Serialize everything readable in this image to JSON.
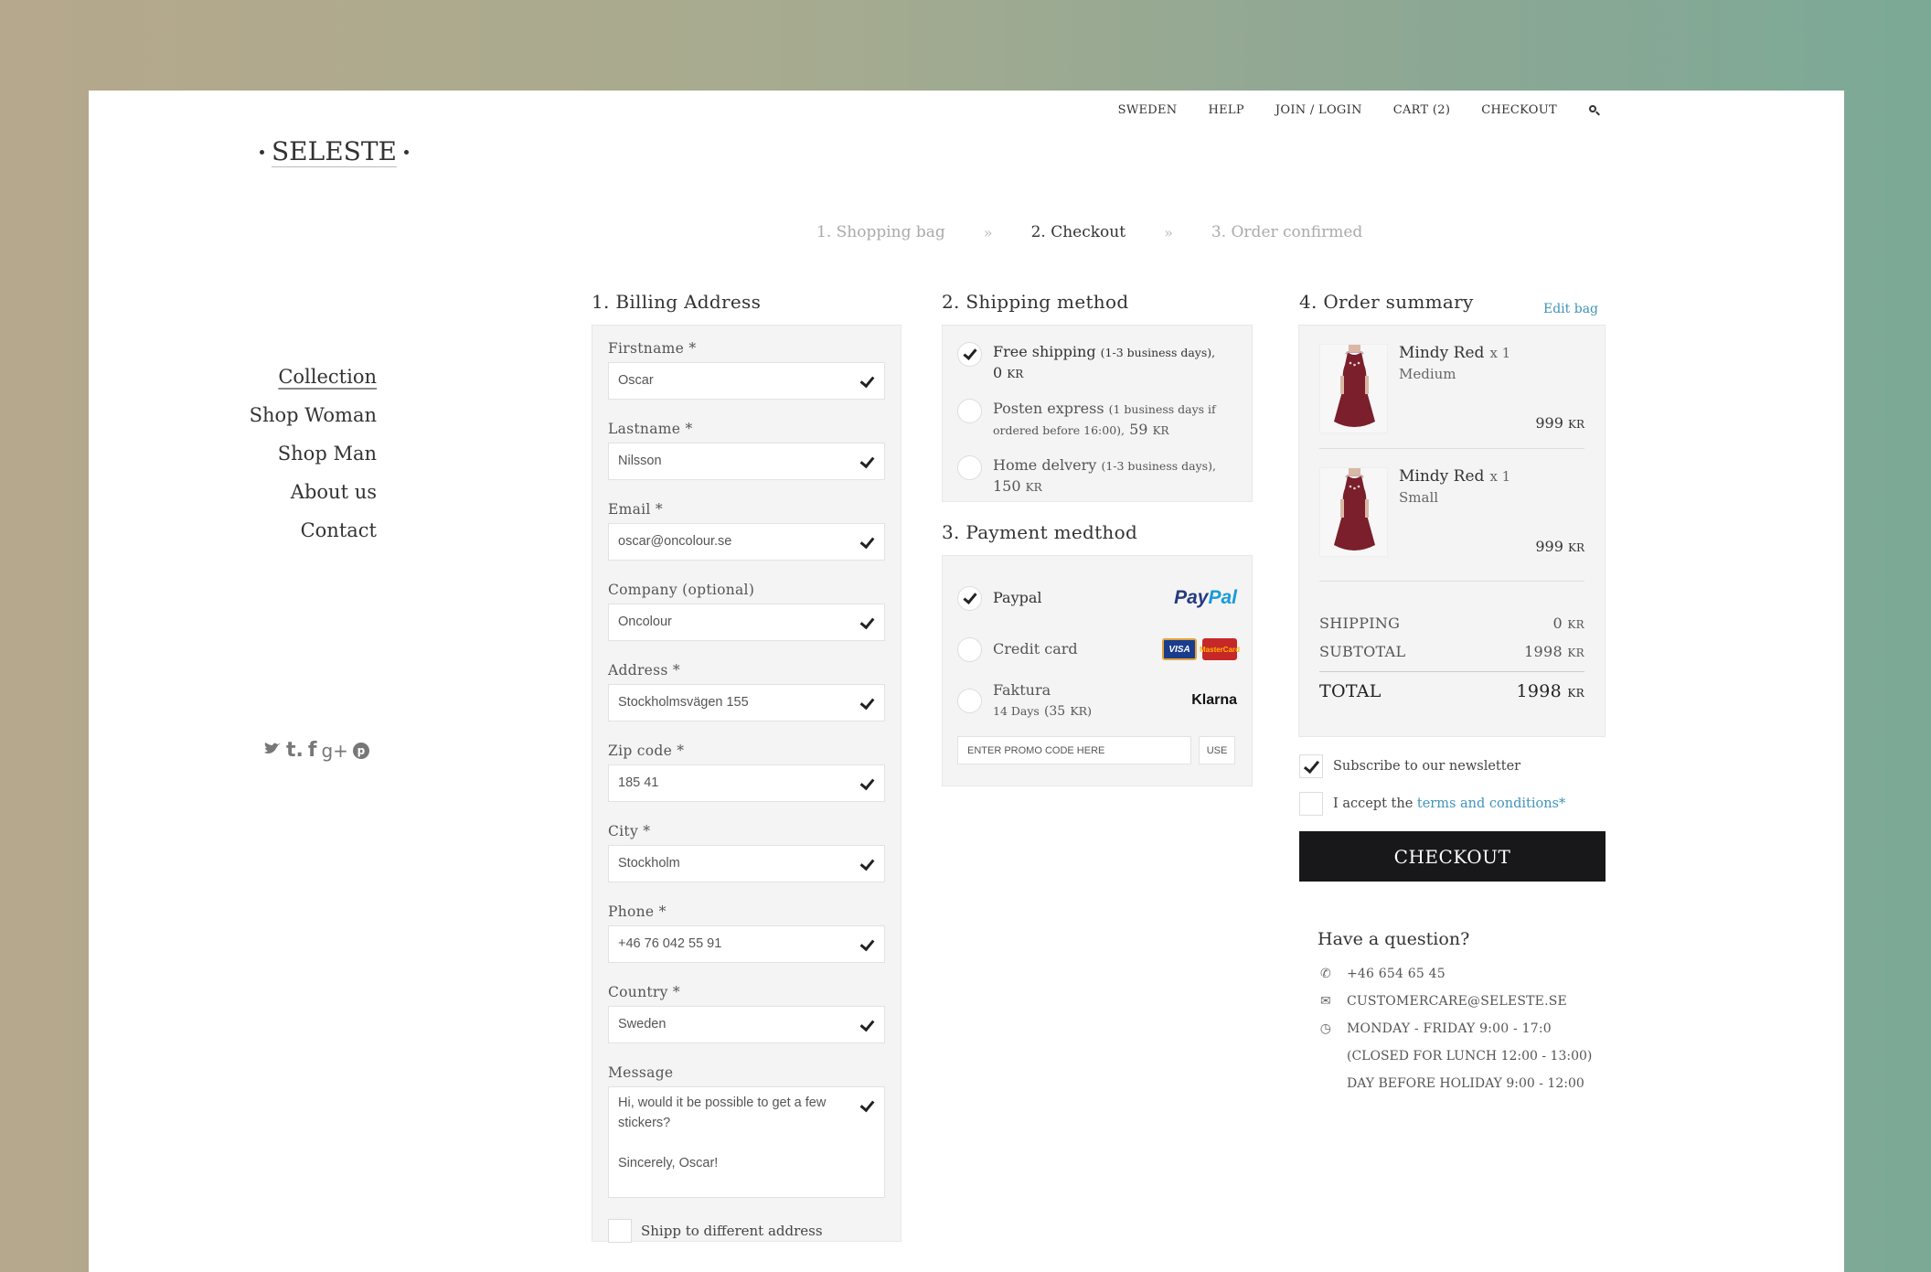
{
  "topnav": {
    "items": [
      "SWEDEN",
      "HELP",
      "JOIN / LOGIN",
      "CART (2)",
      "CHECKOUT"
    ],
    "search_icon": "search-icon"
  },
  "logo": {
    "text": "SELESTE"
  },
  "steps": [
    {
      "label": "1. Shopping bag",
      "active": false
    },
    {
      "label": "2. Checkout",
      "active": true
    },
    {
      "label": "3. Order confirmed",
      "active": false
    }
  ],
  "step_separator": "»",
  "sidenav": {
    "items": [
      "Collection",
      "Shop Woman",
      "Shop Man",
      "About us",
      "Contact"
    ]
  },
  "social": {
    "twitter": "twitter-icon",
    "tumblr": "t.",
    "facebook": "f",
    "googleplus": "g+",
    "pinterest": "p"
  },
  "billing": {
    "title": "1. Billing Address",
    "fields": [
      {
        "label": "Firstname *",
        "value": "Oscar"
      },
      {
        "label": "Lastname *",
        "value": "Nilsson"
      },
      {
        "label": "Email *",
        "value": "oscar@oncolour.se"
      },
      {
        "label": "Company (optional)",
        "value": "Oncolour"
      },
      {
        "label": "Address *",
        "value": "Stockholmsvägen 155"
      },
      {
        "label": "Zip code *",
        "value": "185 41"
      },
      {
        "label": "City *",
        "value": "Stockholm"
      },
      {
        "label": "Phone *",
        "value": "+46 76 042 55 91"
      },
      {
        "label": "Country *",
        "value": "Sweden"
      }
    ],
    "message_label": "Message",
    "message_value": "Hi, would it be possible to get a few stickers?\n\nSincerely, Oscar!",
    "ship_different": "Shipp to different address"
  },
  "shipping": {
    "title": "2. Shipping method",
    "options": [
      {
        "name": "Free shipping",
        "detail": "(1-3 business days),",
        "price": "0",
        "currency": "KR",
        "selected": true
      },
      {
        "name": "Posten express",
        "detail": "(1 business days if ordered before 16:00),",
        "price": "59",
        "currency": "KR",
        "selected": false
      },
      {
        "name": "Home delvery",
        "detail": "(1-3 business days),",
        "price": "150",
        "currency": "KR",
        "selected": false
      }
    ]
  },
  "payment": {
    "title": "3. Payment medthod",
    "paypal": "Paypal",
    "paypal_logo": [
      "Pay",
      "Pal"
    ],
    "credit_card": "Credit card",
    "visa": "VISA",
    "mastercard": "MasterCard",
    "faktura": "Faktura",
    "faktura_detail": "14 Days",
    "faktura_price": "(35",
    "faktura_currency": "KR)",
    "klarna": "Klarna",
    "promo_placeholder": "ENTER PROMO CODE HERE",
    "promo_button": "USE"
  },
  "summary": {
    "title": "4. Order summary",
    "edit_bag": "Edit bag",
    "items": [
      {
        "name": "Mindy Red",
        "qty": "x 1",
        "size": "Medium",
        "price": "999",
        "currency": "KR"
      },
      {
        "name": "Mindy Red",
        "qty": "x 1",
        "size": "Small",
        "price": "999",
        "currency": "KR"
      }
    ],
    "shipping_label": "SHIPPING",
    "shipping_value": "0",
    "subtotal_label": "SUBTOTAL",
    "subtotal_value": "1998",
    "total_label": "TOTAL",
    "total_value": "1998",
    "currency": "KR"
  },
  "newsletter": {
    "label": "Subscribe to our newsletter",
    "checked": true
  },
  "terms": {
    "prefix": "I accept the ",
    "link": "terms and conditions",
    "suffix": "*",
    "checked": false
  },
  "checkout_button": "CHECKOUT",
  "question": {
    "title": "Have a question?",
    "phone": "+46 654 65 45",
    "email": "CUSTOMERCARE@SELESTE.SE",
    "hours": "MONDAY - FRIDAY 9:00 - 17:0",
    "lunch": "(CLOSED FOR LUNCH 12:00 - 13:00)",
    "holiday": "DAY BEFORE HOLIDAY 9:00 - 12:00"
  },
  "colors": {
    "link": "#3f93b9",
    "checkout_bg": "#18181a",
    "dress": "#7a1f2b"
  }
}
